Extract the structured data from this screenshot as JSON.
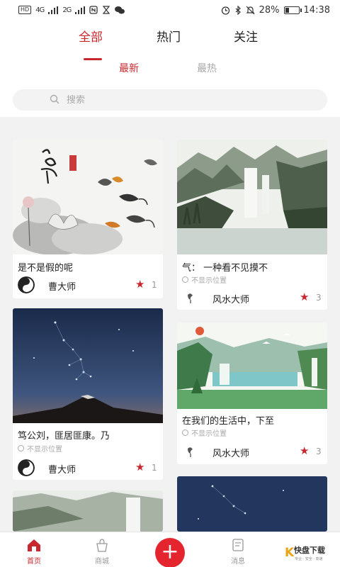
{
  "statusbar": {
    "left_tag": "HD",
    "signal1": "4G",
    "signal2": "2G",
    "battery": "28%",
    "time": "14:38"
  },
  "tabs": [
    {
      "label": "全部"
    },
    {
      "label": "热门"
    },
    {
      "label": "关注"
    }
  ],
  "subtabs": [
    {
      "label": "最新"
    },
    {
      "label": "最热"
    }
  ],
  "search": {
    "placeholder": "搜索"
  },
  "cards": [
    {
      "title": "是不是假的呢",
      "author": "曹大师",
      "count": "1"
    },
    {
      "title": "气：  一种看不见摸不",
      "location": "不显示位置",
      "author": "风水大师",
      "count": "3"
    },
    {
      "title": "笃公刘，匪居匪康。乃",
      "location": "不显示位置",
      "author": "曹大师",
      "count": "1"
    },
    {
      "title": "在我们的生活中，下至",
      "location": "不显示位置",
      "author": "风水大师",
      "count": "3"
    }
  ],
  "nav": [
    {
      "label": "首页"
    },
    {
      "label": "商城"
    },
    {
      "label": "消息"
    }
  ],
  "add_label": "+",
  "watermark": {
    "big": "快盘下载",
    "small": "专业 · 安全 · 高速"
  },
  "colors": {
    "accent": "#c8282d",
    "add_button": "#e5252d"
  }
}
